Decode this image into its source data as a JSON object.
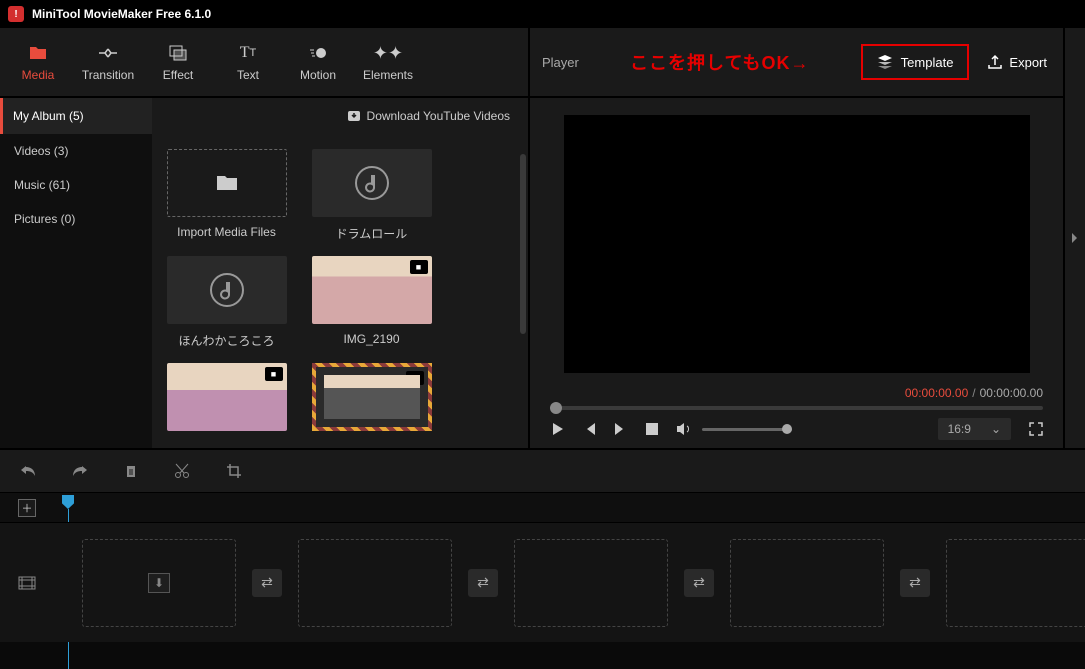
{
  "app": {
    "title": "MiniTool MovieMaker Free 6.1.0",
    "logo_letter": "!"
  },
  "toolbar": [
    {
      "id": "media",
      "label": "Media",
      "active": true
    },
    {
      "id": "transition",
      "label": "Transition",
      "active": false
    },
    {
      "id": "effect",
      "label": "Effect",
      "active": false
    },
    {
      "id": "text",
      "label": "Text",
      "active": false
    },
    {
      "id": "motion",
      "label": "Motion",
      "active": false
    },
    {
      "id": "elements",
      "label": "Elements",
      "active": false
    }
  ],
  "album_header": "My Album (5)",
  "download_yt": "Download YouTube Videos",
  "sidebar": [
    {
      "id": "videos",
      "label": "Videos (3)"
    },
    {
      "id": "music",
      "label": "Music (61)"
    },
    {
      "id": "pictures",
      "label": "Pictures (0)"
    }
  ],
  "media": {
    "import_label": "Import Media Files",
    "items": [
      {
        "name": "ドラムロール",
        "type": "audio"
      },
      {
        "name": "ほんわかころころ",
        "type": "audio"
      },
      {
        "name": "IMG_2190",
        "type": "video"
      }
    ]
  },
  "player": {
    "label": "Player",
    "overlay": "ここを押してもOK→",
    "template": "Template",
    "export": "Export",
    "time_current": "00:00:00.00",
    "time_sep": "/",
    "time_total": "00:00:00.00",
    "ratio": "16:9"
  }
}
